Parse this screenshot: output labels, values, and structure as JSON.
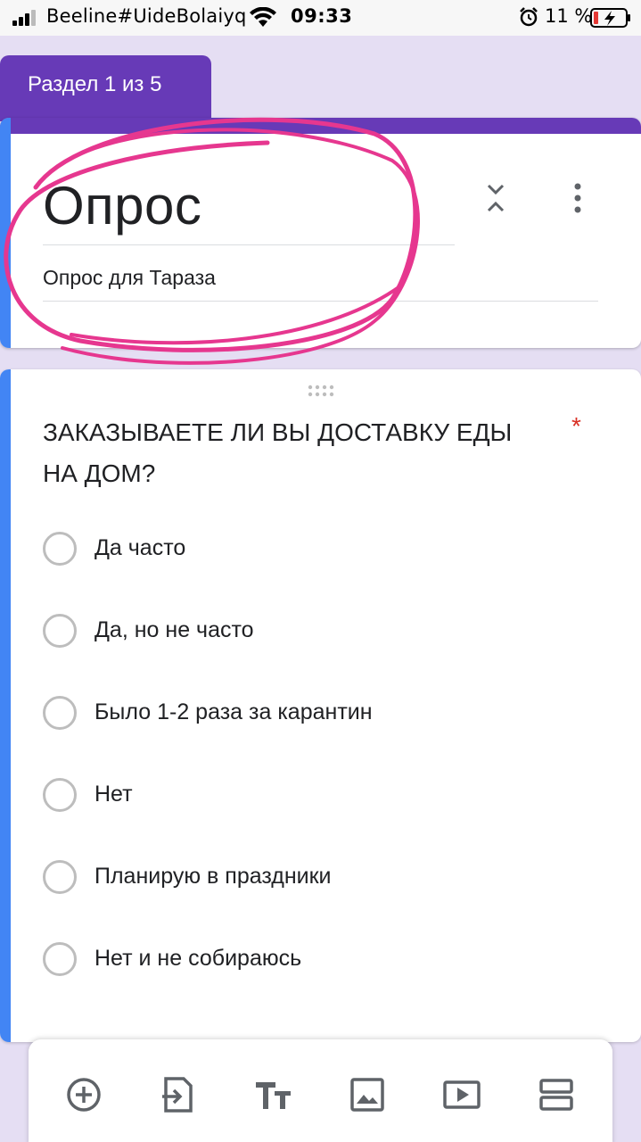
{
  "status_bar": {
    "carrier": "Beeline#UideBolaiyq",
    "time": "09:33",
    "battery_percent": "11 %"
  },
  "section_tab": {
    "label": "Раздел 1 из 5"
  },
  "form_header": {
    "title": "Опрос",
    "description": "Опрос для Тараза"
  },
  "question": {
    "title": "ЗАКАЗЫВАЕТЕ ЛИ ВЫ ДОСТАВКУ ЕДЫ НА ДОМ?",
    "required_mark": "*",
    "options": [
      "Да часто",
      "Да, но не часто",
      "Было 1-2 раза за карантин",
      "Нет",
      "Планирую в праздники",
      "Нет и не собираюсь"
    ]
  },
  "toolbar": {
    "icons": [
      "add-question-icon",
      "import-questions-icon",
      "add-title-icon",
      "add-image-icon",
      "add-video-icon",
      "add-section-icon"
    ]
  },
  "colors": {
    "accent": "#673ab7",
    "focus_bar": "#4285f4",
    "background": "#e5def3",
    "annotation": "#e6378f",
    "required": "#d93025"
  }
}
